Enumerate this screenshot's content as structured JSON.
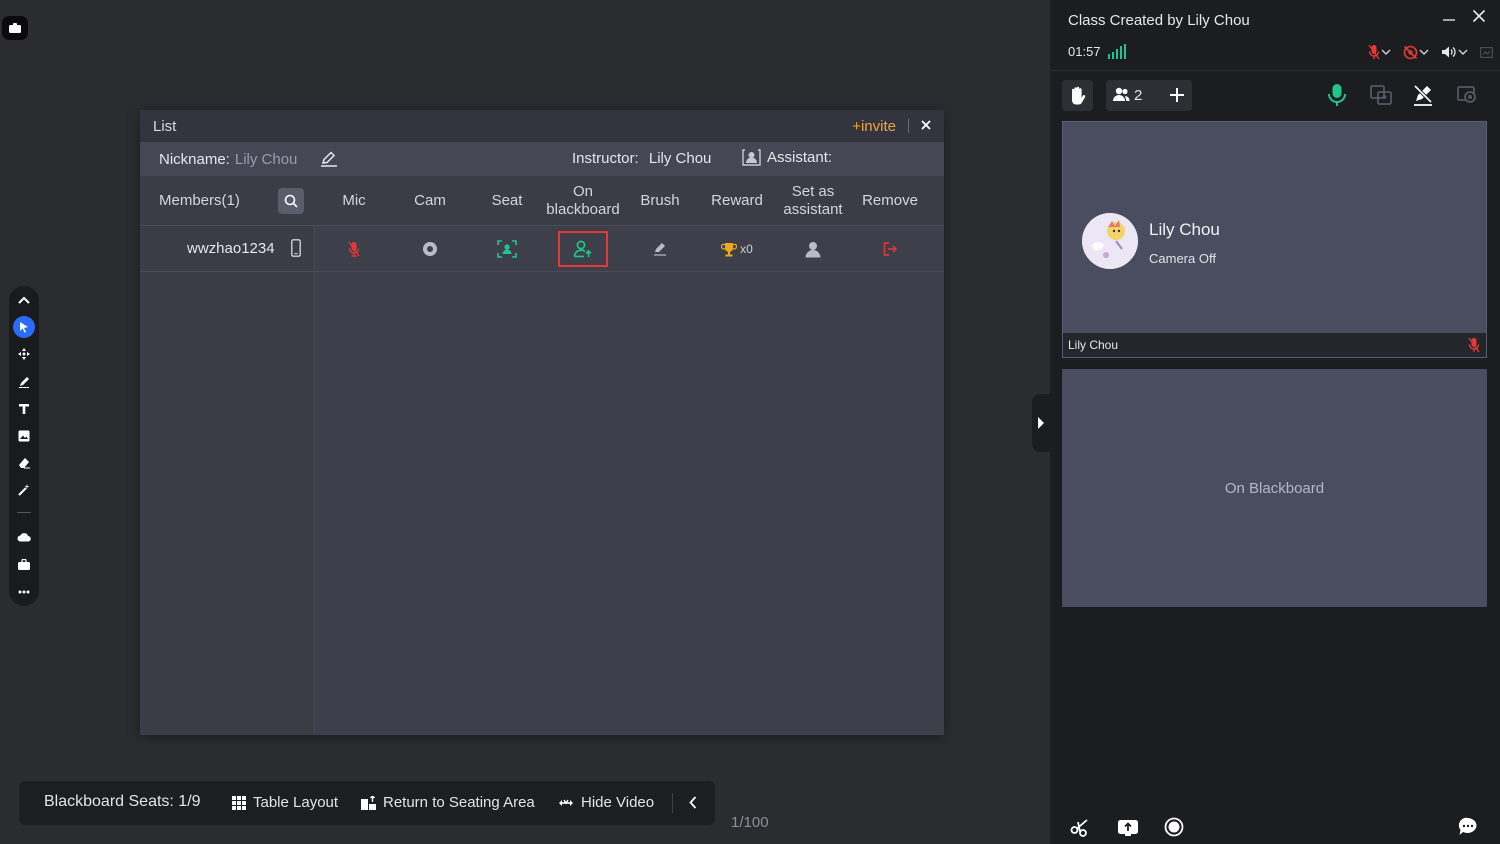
{
  "list_dialog": {
    "title": "List",
    "invite_label": "+invite",
    "nickname_label": "Nickname:",
    "nickname_value": "Lily Chou",
    "instructor_label": "Instructor:",
    "instructor_value": "Lily Chou",
    "assistant_label": "Assistant:",
    "members_label": "Members(1)",
    "columns": [
      "Mic",
      "Cam",
      "Seat",
      "On blackboard",
      "Brush",
      "Reward",
      "Set as assistant",
      "Remove"
    ],
    "members": [
      {
        "name": "wwzhao1234",
        "reward_count": "x0"
      }
    ]
  },
  "bottom_bar": {
    "seats_label": "Blackboard Seats: 1/9",
    "table_layout": "Table Layout",
    "return_seating": "Return to Seating Area",
    "hide_video": "Hide Video"
  },
  "page_counter": "1/100",
  "right_panel": {
    "class_title": "Class Created by Lily Chou",
    "timer": "01:57",
    "people_count": "2",
    "video_tile": {
      "name": "Lily Chou",
      "status": "Camera Off",
      "footer_name": "Lily Chou"
    },
    "blackboard_label": "On Blackboard"
  },
  "colors": {
    "accent_blue": "#2b6cf6",
    "invite_orange": "#f2a33a",
    "green": "#20c58b",
    "red": "#e53935",
    "gold": "#f0a81a"
  }
}
